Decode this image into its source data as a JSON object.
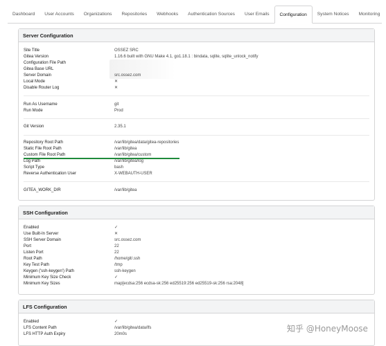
{
  "tabs": [
    {
      "label": "Dashboard"
    },
    {
      "label": "User Accounts"
    },
    {
      "label": "Organizations"
    },
    {
      "label": "Repositories"
    },
    {
      "label": "Webhooks"
    },
    {
      "label": "Authentication Sources"
    },
    {
      "label": "User Emails"
    },
    {
      "label": "Configuration"
    },
    {
      "label": "System Notices"
    },
    {
      "label": "Monitoring"
    }
  ],
  "active_tab": "Configuration",
  "server": {
    "title": "Server Configuration",
    "site_title_k": "Site Title",
    "site_title_v": "OSSEZ SRC",
    "gitea_version_k": "Gitea Version",
    "gitea_version_v": "1.16.6 built with GNU Make 4.1, go1.18.1 : bindata, sqlite, sqlite_unlock_notify",
    "config_path_k": "Configuration File Path",
    "base_url_k": "Gitea Base URL",
    "server_domain_k": "Server Domain",
    "server_domain_v": "src.ossez.com",
    "local_mode_k": "Local Mode",
    "local_mode_v": "✕",
    "disable_router_log_k": "Disable Router Log",
    "disable_router_log_v": "✕",
    "run_as_k": "Run As Username",
    "run_as_v": "git",
    "run_mode_k": "Run Mode",
    "run_mode_v": "Prod",
    "git_version_k": "Git Version",
    "git_version_v": "2.35.1",
    "repo_root_k": "Repository Root Path",
    "repo_root_v": "/var/lib/gitea/data/gitea-repositories",
    "static_root_k": "Static File Root Path",
    "static_root_v": "/var/lib/gitea",
    "custom_root_k": "Custom File Root Path",
    "custom_root_v": "/var/lib/gitea/custom",
    "log_path_k": "Log Path",
    "log_path_v": "/var/lib/gitea/log",
    "script_type_k": "Script Type",
    "script_type_v": "bash",
    "reverse_auth_k": "Reverse Authentication User",
    "reverse_auth_v": "X-WEBAUTH-USER",
    "work_dir_k": "GITEA_WORK_DIR",
    "work_dir_v": "/var/lib/gitea"
  },
  "ssh": {
    "title": "SSH Configuration",
    "enabled_k": "Enabled",
    "enabled_v": "✓",
    "builtin_k": "Use Built-In Server",
    "builtin_v": "✕",
    "domain_k": "SSH Server Domain",
    "domain_v": "src.ossez.com",
    "port_k": "Port",
    "port_v": "22",
    "listen_port_k": "Listen Port",
    "listen_port_v": "22",
    "root_path_k": "Root Path",
    "root_path_v": "/home/git/.ssh",
    "key_test_k": "Key Test Path",
    "key_test_v": "/tmp",
    "keygen_k": "Keygen ('ssh-keygen') Path",
    "keygen_v": "ssh-keygen",
    "min_check_k": "Minimum Key Size Check",
    "min_check_v": "✓",
    "min_sizes_k": "Minimum Key Sizes",
    "min_sizes_v": "map[ecdsa:256 ecdsa-sk:256 ed25519:256 ed25519-sk:256 rsa:2048]"
  },
  "lfs": {
    "title": "LFS Configuration",
    "enabled_k": "Enabled",
    "enabled_v": "✓",
    "content_k": "LFS Content Path",
    "content_v": "/var/lib/gitea/data/lfs",
    "expiry_k": "LFS HTTP Auth Expiry",
    "expiry_v": "20m0s"
  },
  "watermark": "知乎 @HoneyMoose"
}
